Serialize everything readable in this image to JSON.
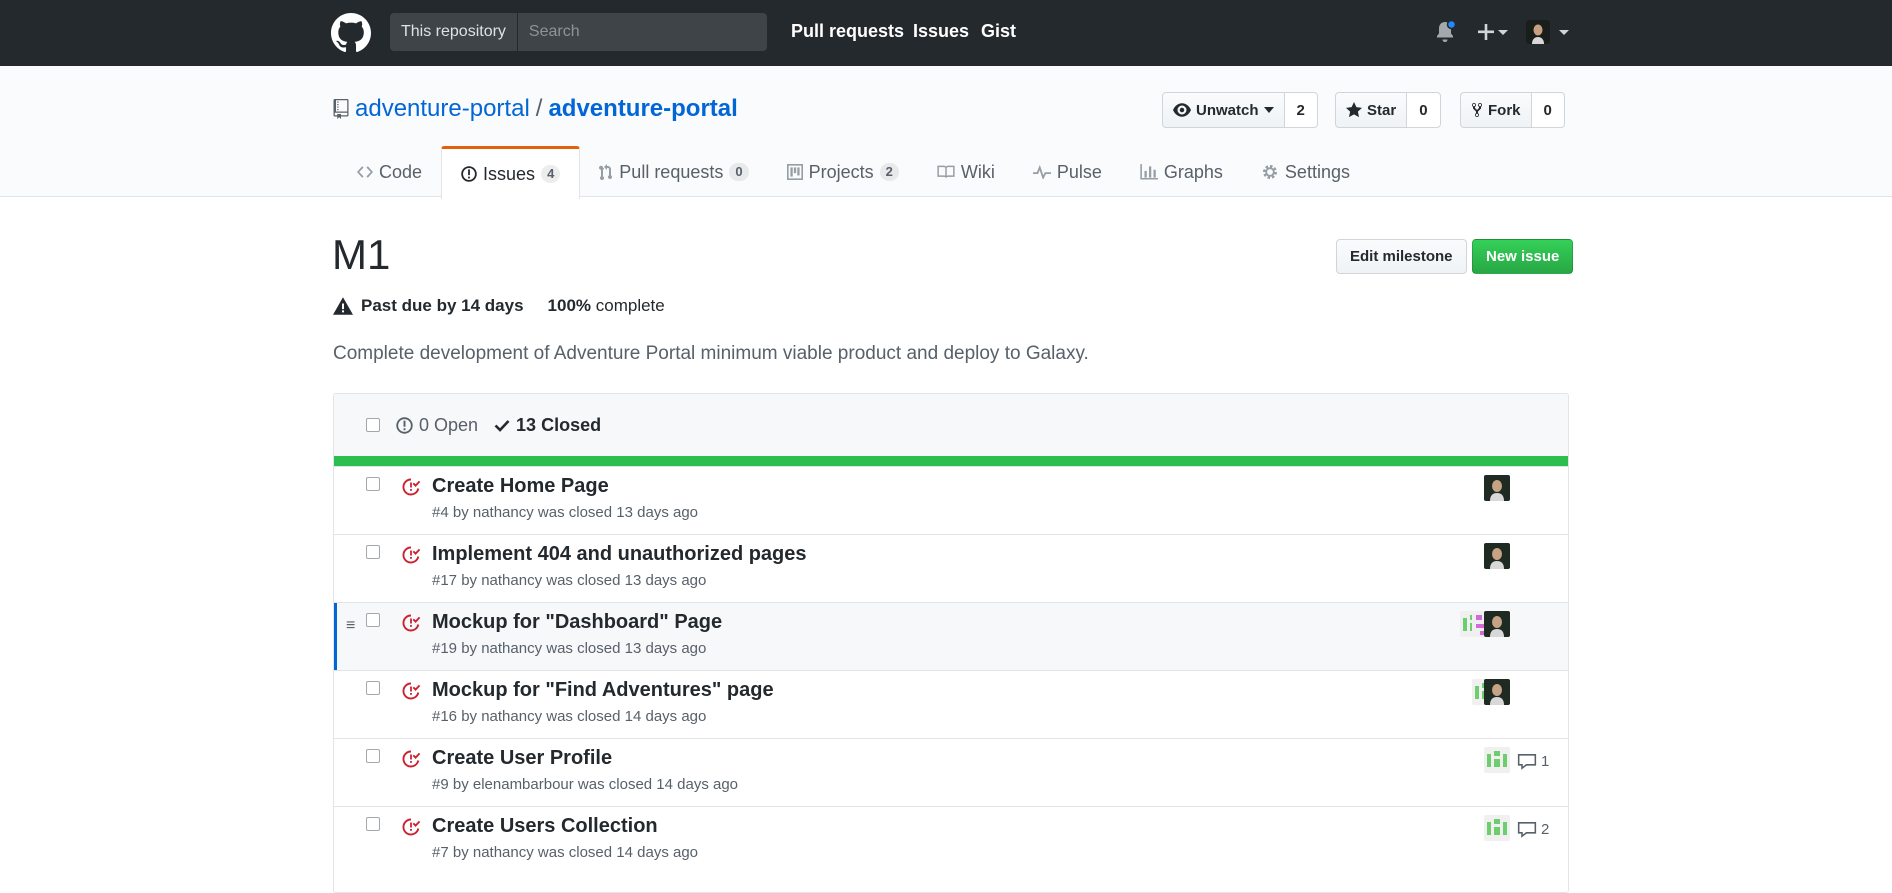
{
  "header": {
    "search_scope": "This repository",
    "search_placeholder": "Search",
    "nav": [
      "Pull requests",
      "Issues",
      "Gist"
    ]
  },
  "repo": {
    "owner": "adventure-portal",
    "separator": "/",
    "name": "adventure-portal",
    "watch_label": "Unwatch",
    "watch_count": "2",
    "star_label": "Star",
    "star_count": "0",
    "fork_label": "Fork",
    "fork_count": "0"
  },
  "tabs": [
    {
      "label": "Code",
      "icon": "code-icon"
    },
    {
      "label": "Issues",
      "icon": "issue-opened-icon",
      "count": "4"
    },
    {
      "label": "Pull requests",
      "icon": "git-pull-request-icon",
      "count": "0"
    },
    {
      "label": "Projects",
      "icon": "project-icon",
      "count": "2"
    },
    {
      "label": "Wiki",
      "icon": "book-icon"
    },
    {
      "label": "Pulse",
      "icon": "pulse-icon"
    },
    {
      "label": "Graphs",
      "icon": "graph-icon"
    },
    {
      "label": "Settings",
      "icon": "gear-icon"
    }
  ],
  "milestone": {
    "title": "M1",
    "edit_label": "Edit milestone",
    "new_issue_label": "New issue",
    "due": "Past due by 14 days",
    "percent": "100%",
    "complete_label": "complete",
    "progress": 1.0,
    "description": "Complete development of Adventure Portal minimum viable product and deploy to Galaxy."
  },
  "issues_box": {
    "open_label": "0 Open",
    "closed_label": "13 Closed"
  },
  "issues": [
    {
      "title": "Create Home Page",
      "meta": "#4 by nathancy was closed 13 days ago",
      "avatars": [
        "photo"
      ],
      "comments": ""
    },
    {
      "title": "Implement 404 and unauthorized pages",
      "meta": "#17 by nathancy was closed 13 days ago",
      "avatars": [
        "photo"
      ],
      "comments": ""
    },
    {
      "title": "Mockup for \"Dashboard\" Page",
      "meta": "#19 by nathancy was closed 13 days ago",
      "avatars": [
        "green",
        "pink",
        "photo"
      ],
      "comments": ""
    },
    {
      "title": "Mockup for \"Find Adventures\" page",
      "meta": "#16 by nathancy was closed 14 days ago",
      "avatars": [
        "green",
        "photo"
      ],
      "comments": ""
    },
    {
      "title": "Create User Profile",
      "meta": "#9 by elenambarbour was closed 14 days ago",
      "avatars": [
        "green"
      ],
      "comments": "1"
    },
    {
      "title": "Create Users Collection",
      "meta": "#7 by nathancy was closed 14 days ago",
      "avatars": [
        "green"
      ],
      "comments": "2"
    }
  ]
}
